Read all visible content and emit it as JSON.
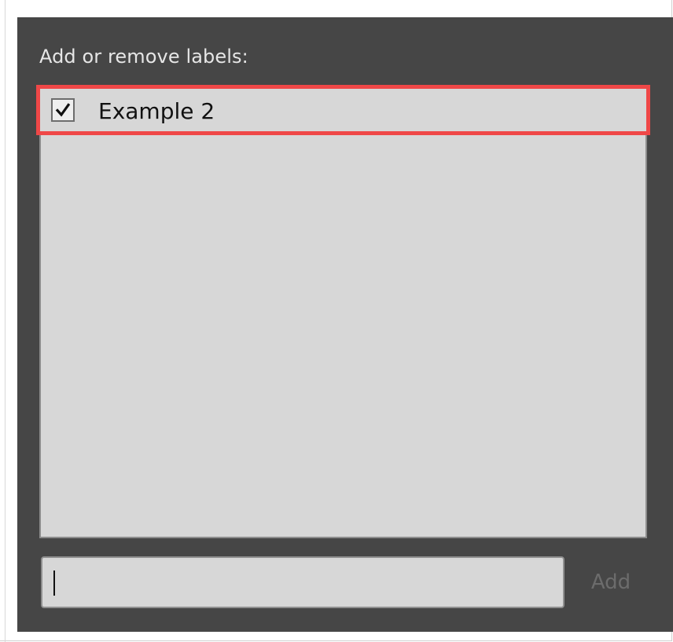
{
  "dialog": {
    "title": "Add or remove labels:"
  },
  "labels_list": {
    "items": [
      {
        "label": "Example 2",
        "checked": true,
        "highlighted": true
      }
    ]
  },
  "new_label": {
    "value": "",
    "placeholder": ""
  },
  "add_button": {
    "label": "Add",
    "enabled": false
  },
  "colors": {
    "panel_background": "#464646",
    "list_background": "#d7d7d7",
    "highlight_border": "#ef4747",
    "disabled_text": "#6c6c6c"
  },
  "icons": {
    "checkbox": "checkmark-icon"
  }
}
